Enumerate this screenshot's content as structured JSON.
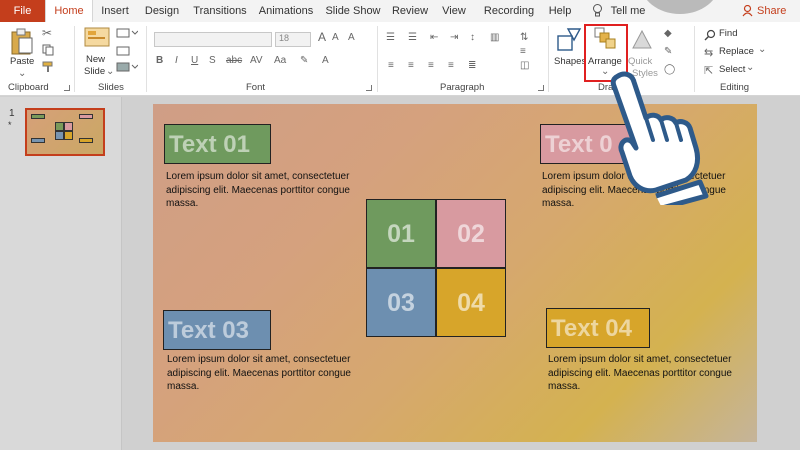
{
  "tabs": {
    "file": "File",
    "home": "Home",
    "insert": "Insert",
    "design": "Design",
    "transitions": "Transitions",
    "animations": "Animations",
    "slideshow": "Slide Show",
    "review": "Review",
    "view": "View",
    "recording": "Recording",
    "help": "Help",
    "tellme": "Tell me",
    "share": "Share"
  },
  "ribbon": {
    "clipboard": {
      "label": "Clipboard",
      "paste": "Paste"
    },
    "slides": {
      "label": "Slides",
      "new_slide_1": "New",
      "new_slide_2": "Slide"
    },
    "font": {
      "label": "Font",
      "size": "18"
    },
    "paragraph": {
      "label": "Paragraph"
    },
    "drawing": {
      "label": "Dra",
      "shapes": "Shapes",
      "arrange": "Arrange",
      "quick_styles_1": "Quick",
      "quick_styles_2": "Styles"
    },
    "editing": {
      "label": "Editing",
      "find": "Find",
      "replace": "Replace",
      "select": "Select"
    }
  },
  "slide_panel": {
    "number": "1",
    "star": "*"
  },
  "slide": {
    "text01": "Text 01",
    "text02": "Text 0",
    "text03": "Text 03",
    "text04": "Text 04",
    "lorem": "Lorem ipsum dolor sit amet, consectetuer adipiscing elit. Maecenas porttitor congue massa.",
    "q1": "01",
    "q2": "02",
    "q3": "03",
    "q4": "04"
  },
  "colors": {
    "accent": "#c43e1c",
    "green_box": "#6f9a5e",
    "pink_box": "#d89aa0",
    "blue_box": "#6d8fb0",
    "yellow_box": "#d7a52a",
    "hand_outline": "#2e5a8a",
    "highlight": "#e02020"
  }
}
